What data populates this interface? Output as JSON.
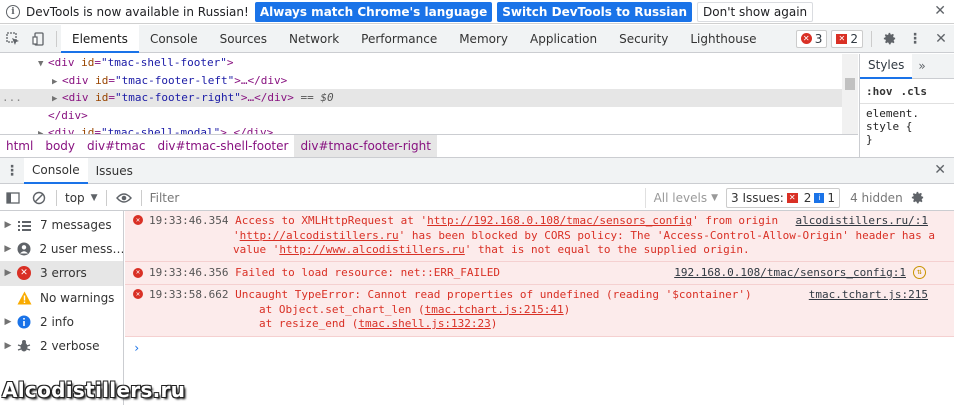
{
  "infobar": {
    "text": "DevTools is now available in Russian!",
    "btn_match": "Always match Chrome's language",
    "btn_switch": "Switch DevTools to Russian",
    "btn_dismiss": "Don't show again"
  },
  "main_tabs": [
    "Elements",
    "Console",
    "Sources",
    "Network",
    "Performance",
    "Memory",
    "Application",
    "Security",
    "Lighthouse"
  ],
  "badges": {
    "errors": "3",
    "issues": "2"
  },
  "elements": {
    "lines": [
      {
        "tri": "▼",
        "tag_open": "<div ",
        "attr": "id",
        "val": "\"tmac-shell-footer\"",
        "tag_close": ">",
        "tail": ""
      },
      {
        "tri": "▶",
        "tag_open": "<div ",
        "attr": "id",
        "val": "\"tmac-footer-left\"",
        "tag_close": ">…</div>",
        "tail": ""
      },
      {
        "tri": "▶",
        "tag_open": "<div ",
        "attr": "id",
        "val": "\"tmac-footer-right\"",
        "tag_close": ">…</div>",
        "tail": " == $0"
      },
      {
        "tri": "",
        "tag_open": "</div>",
        "attr": "",
        "val": "",
        "tag_close": "",
        "tail": ""
      },
      {
        "tri": "▶",
        "tag_open": "<div ",
        "attr": "id",
        "val": "\"tmac-shell-modal\"",
        "tag_close": ">…</div>",
        "tail": ""
      }
    ],
    "dots": "..."
  },
  "styles": {
    "tab": "Styles",
    "more": "»",
    "hov": ":hov",
    "cls": ".cls",
    "rule1": "element.",
    "rule2": "style {",
    "rule3": "}"
  },
  "breadcrumb": [
    "html",
    "body",
    "div#tmac",
    "div#tmac-shell-footer",
    "div#tmac-footer-right"
  ],
  "drawer": {
    "tabs": [
      "Console",
      "Issues"
    ]
  },
  "console_toolbar": {
    "context": "top",
    "filter_placeholder": "Filter",
    "levels": "All levels",
    "issues_label": "3 Issues:",
    "issues_err": "2",
    "issues_info": "1",
    "hidden": "4 hidden"
  },
  "sidebar": [
    {
      "label": "7 messages",
      "icon": "list-icon"
    },
    {
      "label": "2 user mess…",
      "icon": "user-icon"
    },
    {
      "label": "3 errors",
      "icon": "error-icon"
    },
    {
      "label": "No warnings",
      "icon": "warning-icon"
    },
    {
      "label": "2 info",
      "icon": "info-icon"
    },
    {
      "label": "2 verbose",
      "icon": "bug-icon"
    }
  ],
  "messages": {
    "m1": {
      "time": "19:33:46.354",
      "l1a": "Access to XMLHttpRequest at '",
      "l1link": "http://192.168.0.108/tmac/sensors_config",
      "l1b": "' from origin",
      "l2a": "'",
      "l2link": "http://alcodistillers.ru",
      "l2b": "' has been blocked by CORS policy: The 'Access-Control-Allow-Origin' header has a",
      "l3a": "value '",
      "l3link": "http://www.alcodistillers.ru",
      "l3b": "' that is not equal to the supplied origin.",
      "src": "alcodistillers.ru/:1"
    },
    "m2": {
      "time": "19:33:46.356",
      "text": "Failed to load resource: net::ERR_FAILED",
      "src": "192.168.0.108/tmac/sensors_config:1"
    },
    "m3": {
      "time": "19:33:58.662",
      "text": "Uncaught TypeError: Cannot read properties of undefined (reading '$container')",
      "at1a": "at Object.set_chart_len (",
      "at1link": "tmac.tchart.js:215:41",
      "at1b": ")",
      "at2a": "at resize_end (",
      "at2link": "tmac.shell.js:132:23",
      "at2b": ")",
      "src": "tmac.tchart.js:215"
    },
    "prompt": "›"
  },
  "watermark": "Alcodistillers.ru"
}
